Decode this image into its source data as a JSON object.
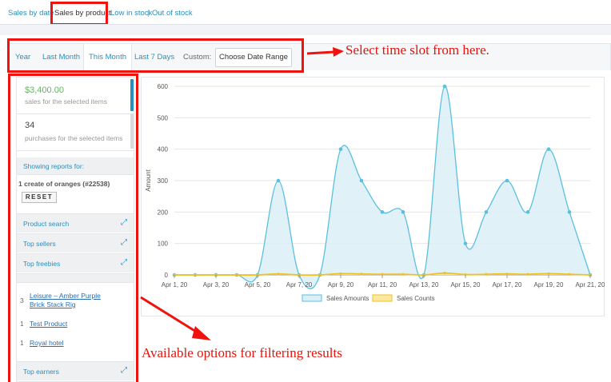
{
  "subnav": {
    "links": [
      "Sales by date",
      "Sales by product",
      "Low in stock",
      "Out of stock"
    ],
    "separator": "|"
  },
  "range": {
    "tabs": [
      "Year",
      "Last Month",
      "This Month",
      "Last 7 Days"
    ],
    "active": "This Month",
    "custom_label": "Custom:",
    "date_button": "Choose Date Range"
  },
  "annotations": {
    "top": "Select time slot from here.",
    "bottom": "Available options for filtering results"
  },
  "sidebar": {
    "stats": [
      {
        "value": "$3,400.00",
        "desc": "sales for the selected items",
        "color": "#5cb85c"
      },
      {
        "value": "34",
        "desc": "purchases for the selected items",
        "color": "#444444"
      }
    ],
    "showing_label": "Showing reports for:",
    "selected_item": "1 create of oranges (#22538)",
    "reset_label": "RESET",
    "filters": [
      "Product search",
      "Top sellers",
      "Top freebies"
    ],
    "freebies": [
      {
        "count": "3",
        "name": "Leisure – Amber Purple Brick Stack Rig"
      },
      {
        "count": "1",
        "name": "Test Product"
      },
      {
        "count": "1",
        "name": "Royal hotel"
      }
    ],
    "bottom_filter": "Top earners",
    "expand_icon": "expand-icon"
  },
  "chart_data": {
    "type": "area",
    "ylabel": "Amount",
    "ylim": [
      0,
      600
    ],
    "yticks": [
      0,
      100,
      200,
      300,
      400,
      500,
      600
    ],
    "x": [
      "Apr 1, 20",
      "Apr 2, 20",
      "Apr 3, 20",
      "Apr 4, 20",
      "Apr 5, 20",
      "Apr 6, 20",
      "Apr 7, 20",
      "Apr 8, 20",
      "Apr 9, 20",
      "Apr 10, 20",
      "Apr 11, 20",
      "Apr 12, 20",
      "Apr 13, 20",
      "Apr 14, 20",
      "Apr 15, 20",
      "Apr 16, 20",
      "Apr 17, 20",
      "Apr 18, 20",
      "Apr 19, 20",
      "Apr 20, 20",
      "Apr 21, 20"
    ],
    "xticks": [
      "Apr 1, 20",
      "Apr 3, 20",
      "Apr 5, 20",
      "Apr 7, 20",
      "Apr 9, 20",
      "Apr 11, 20",
      "Apr 13, 20",
      "Apr 15, 20",
      "Apr 17, 20",
      "Apr 19, 20",
      "Apr 21, 20"
    ],
    "series": [
      {
        "name": "Sales Amounts",
        "color": "#5bc0de",
        "fill": "#dceff7",
        "values": [
          0,
          0,
          0,
          0,
          0,
          300,
          0,
          0,
          400,
          300,
          200,
          200,
          0,
          600,
          100,
          200,
          300,
          200,
          400,
          200,
          0
        ]
      },
      {
        "name": "Sales Counts",
        "color": "#f0c020",
        "fill": "#fbe9a0",
        "values": [
          0,
          0,
          0,
          0,
          0,
          3,
          0,
          0,
          4,
          3,
          2,
          2,
          0,
          6,
          1,
          2,
          3,
          2,
          4,
          2,
          0
        ]
      }
    ],
    "legend_position": "bottom",
    "grid": true
  }
}
